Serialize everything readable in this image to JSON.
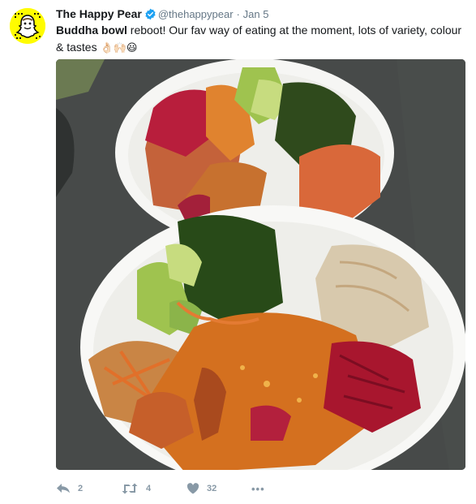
{
  "tweet": {
    "author_name": "The Happy Pear",
    "author_handle": "@thehappypear",
    "separator": "·",
    "date": "Jan 5",
    "text_bold": "Buddha bowl",
    "text_main": " reboot! Our fav way of eating at the moment, lots of variety, colour & tastes ",
    "emojis": "👌🏻🙌🏻😃",
    "media_alt": "Two white bowls of food: lentil dal, beetroot, carrot slaw, kale, avocado, sweet potato and brown rice"
  },
  "actions": {
    "reply_count": "2",
    "retweet_count": "4",
    "like_count": "32",
    "more_label": "•••"
  },
  "colors": {
    "verified": "#1da1f2",
    "avatar_bg": "#fffc00",
    "muted": "#657786",
    "action_icon": "#8899a6"
  },
  "icons": {
    "avatar": "snapchat-ghost-avatar",
    "verified": "verified-badge-icon",
    "reply": "reply-icon",
    "retweet": "retweet-icon",
    "like": "heart-icon",
    "more": "more-dots-icon"
  }
}
